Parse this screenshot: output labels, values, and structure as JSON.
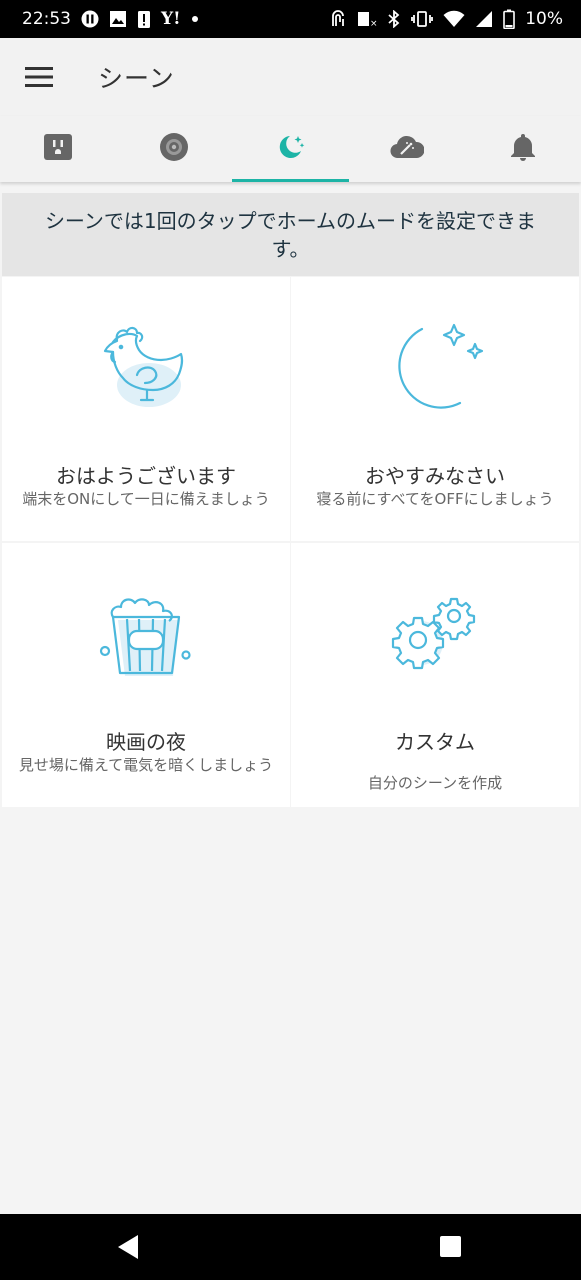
{
  "status_bar": {
    "time": "22:53",
    "yahoo": "Y!",
    "battery": "10%",
    "icons_left": [
      "pause-icon",
      "image-icon",
      "alert-icon",
      "yahoo-icon",
      "dot-icon"
    ],
    "icons_right": [
      "nfc-icon",
      "no-sim-icon",
      "bluetooth-icon",
      "vibrate-icon",
      "wifi-icon",
      "signal-icon",
      "battery-icon"
    ]
  },
  "app_bar": {
    "title": "シーン"
  },
  "tabs": [
    {
      "name": "plug",
      "icon": "smart-plug-icon"
    },
    {
      "name": "camera",
      "icon": "camera-icon"
    },
    {
      "name": "scenes",
      "icon": "moon-stars-icon",
      "active": true
    },
    {
      "name": "automation",
      "icon": "cloud-wand-icon"
    },
    {
      "name": "notifications",
      "icon": "bell-icon"
    }
  ],
  "banner": {
    "text": "シーンでは1回のタップでホームのムードを設定できます。"
  },
  "scenes": [
    {
      "title": "おはようございます",
      "desc": "端末をONにして一日に備えましょう",
      "icon": "rooster-icon"
    },
    {
      "title": "おやすみなさい",
      "desc": "寝る前にすべてをOFFにしましょう",
      "icon": "moon-icon"
    },
    {
      "title": "映画の夜",
      "desc": "見せ場に備えて電気を暗くしましょう",
      "icon": "popcorn-icon"
    },
    {
      "title": "カスタム",
      "desc": "自分のシーンを作成",
      "icon": "gears-icon"
    }
  ],
  "colors": {
    "accent": "#1db4a6",
    "icon_stroke": "#4bb8dc",
    "icon_shadow": "#cfe9f5"
  }
}
